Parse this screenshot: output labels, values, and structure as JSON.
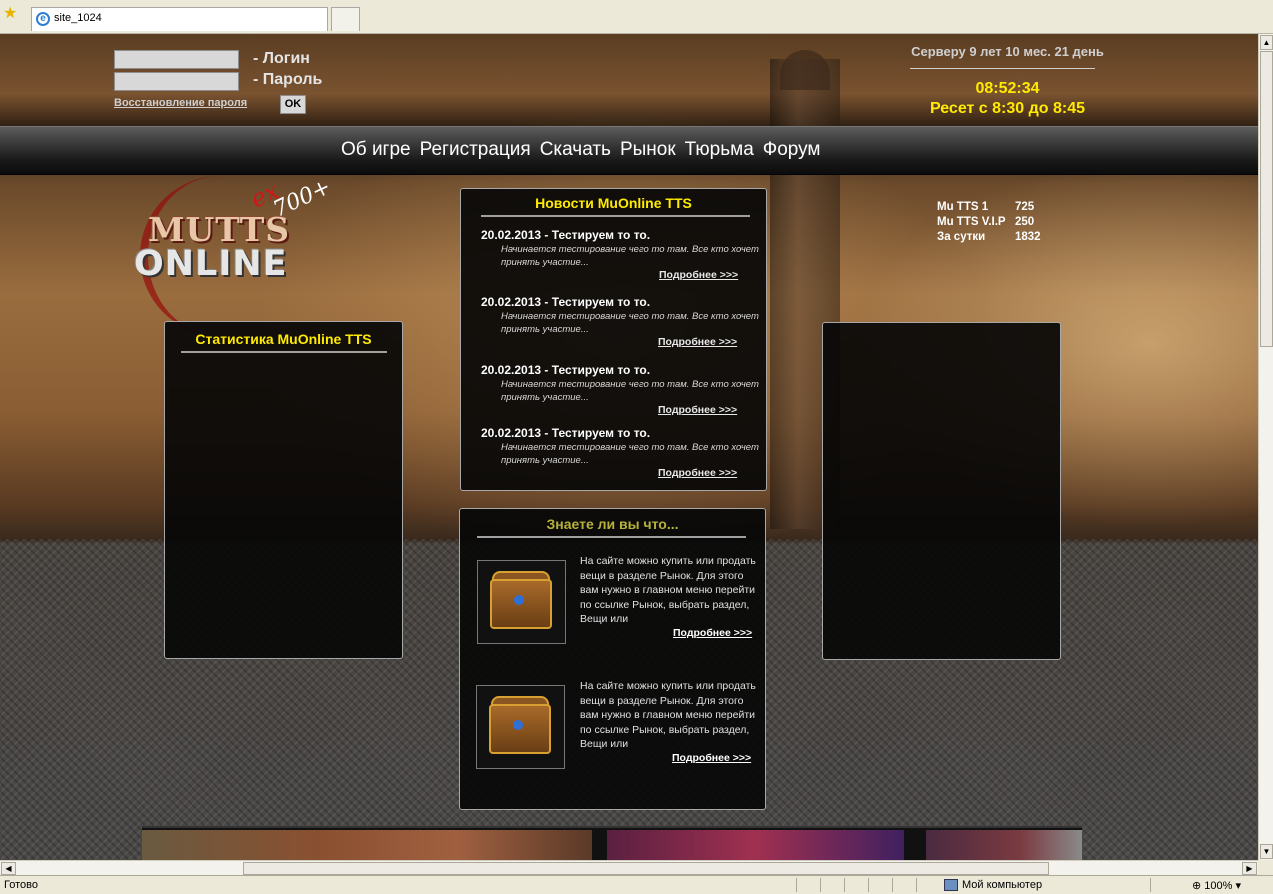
{
  "browser": {
    "tab_title": "site_1024",
    "status_text": "Готово",
    "zone_text": "Мой компьютер",
    "zoom_text": "100%"
  },
  "login": {
    "login_label": "- Логин",
    "password_label": "- Пароль",
    "restore_link": "Восстановление пароля",
    "ok_label": "OK"
  },
  "server": {
    "uptime": "Серверу 9 лет 10 мес. 21 день",
    "clock": "08:52:34",
    "reset": "Ресет с 8:30 до 8:45"
  },
  "nav": {
    "items": [
      "Об игре",
      "Регистрация",
      "Скачать",
      "Рынок",
      "Тюрьма",
      "Форум"
    ]
  },
  "logo": {
    "line1": "MUTTS",
    "line2": "ONLINE",
    "ex": "ex",
    "level": "700+"
  },
  "online": [
    {
      "name": "Mu TTS 1",
      "count": "725"
    },
    {
      "name": "Mu TTS V.I.P",
      "count": "250"
    },
    {
      "name": "За сутки",
      "count": "1832"
    }
  ],
  "stats_panel": {
    "title": "Статистика MuOnline TTS"
  },
  "news": {
    "title": "Новости MuOnline TTS",
    "items": [
      {
        "date": "20.02.2013 - Тестируем то то.",
        "text": "Начинается тестирование чего то там. Все кто хочет принять участие...",
        "more": "Подробнее >>>"
      },
      {
        "date": "20.02.2013 - Тестируем то то.",
        "text": "Начинается тестирование чего то там. Все кто хочет принять участие...",
        "more": "Подробнее >>>"
      },
      {
        "date": "20.02.2013 - Тестируем то то.",
        "text": "Начинается тестирование чего то там. Все кто хочет принять участие...",
        "more": "Подробнее >>>"
      },
      {
        "date": "20.02.2013 - Тестируем то то.",
        "text": "Начинается тестирование чего то там. Все кто хочет принять участие...",
        "more": "Подробнее >>>"
      }
    ]
  },
  "facts": {
    "title": "Знаете ли вы что...",
    "items": [
      {
        "text": "На сайте можно купить или продать вещи в разделе Рынок. Для этого вам нужно в главном меню перейти по ссылке Рынок, выбрать раздел, Вещи или",
        "more": "Подробнее >>>"
      },
      {
        "text": "На сайте можно купить или продать вещи в разделе Рынок. Для этого вам нужно в главном меню перейти по ссылке Рынок, выбрать раздел, Вещи или",
        "more": "Подробнее >>>"
      }
    ]
  },
  "colors": {
    "accent_yellow": "#ffea00",
    "facts_title": "#b5b23a"
  }
}
